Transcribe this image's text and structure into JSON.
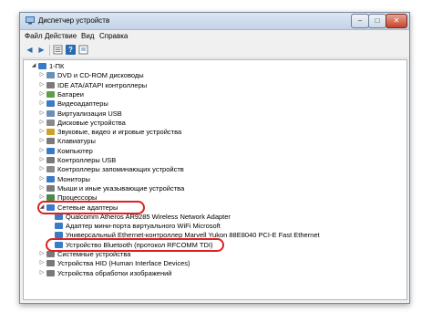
{
  "window": {
    "title": "Диспетчер устройств",
    "controls": {
      "minimize": "–",
      "maximize": "□",
      "close": "✕"
    }
  },
  "menu": [
    "Файл",
    "Действие",
    "Вид",
    "Справка"
  ],
  "toolbar": {
    "icons": [
      "back-icon",
      "forward-icon",
      "properties-icon",
      "help-icon",
      "refresh-icon"
    ]
  },
  "tree": {
    "root": "1-ПК",
    "categories": [
      "DVD и CD-ROM дисководы",
      "IDE ATA/ATAPI контроллеры",
      "Батареи",
      "Видеоадаптеры",
      "Виртуализация USB",
      "Дисковые устройства",
      "Звуковые, видео и игровые устройства",
      "Клавиатуры",
      "Компьютер",
      "Контроллеры USB",
      "Контроллеры запоминающих устройств",
      "Мониторы",
      "Мыши и иные указывающие устройства",
      "Процессоры",
      "Сетевые адаптеры"
    ],
    "network_children": [
      "Qualcomm Atheros AR9285 Wireless Network Adapter",
      "Адаптер мини-порта виртуального WiFi Microsoft",
      "Универсальный Ethernet-контроллер Marvell Yukon 88E8040 PCI-E Fast Ethernet",
      "Устройство Bluetooth (протокол RFCOMM TDI)"
    ],
    "after": [
      "Системные устройства",
      "Устройства HID (Human Interface Devices)",
      "Устройства обработки изображений"
    ]
  },
  "colors": {
    "highlight": "#e02020",
    "title_gradient_top": "#dbe6f3"
  }
}
